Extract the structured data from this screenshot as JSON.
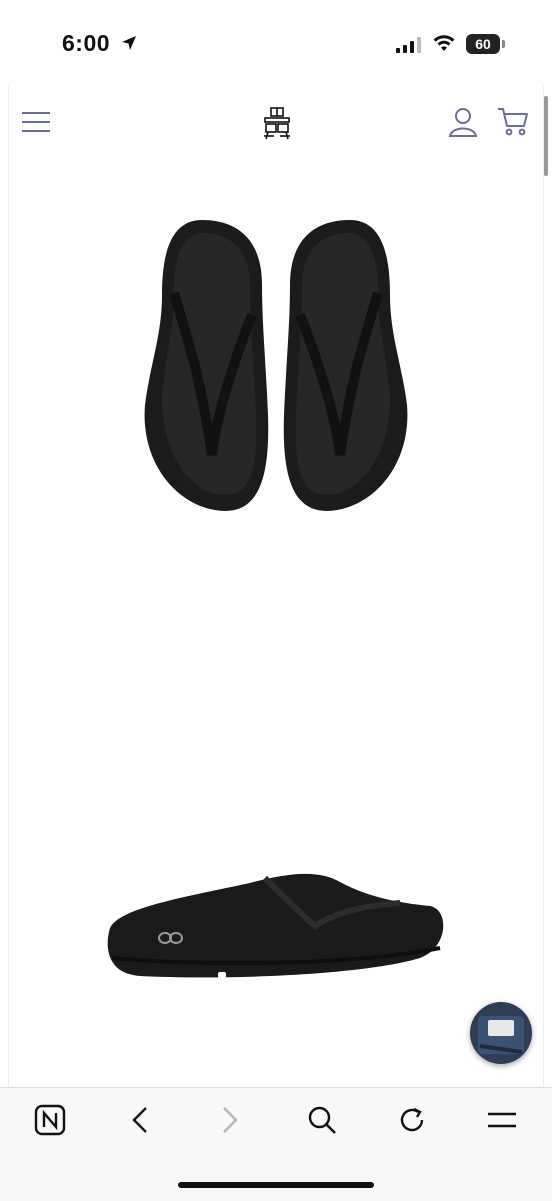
{
  "status_bar": {
    "time": "6:00",
    "battery_level": "60",
    "icons": [
      "location-arrow-icon",
      "cellular-signal-icon",
      "wifi-icon",
      "battery-icon"
    ]
  },
  "header": {
    "menu_icon": "hamburger-menu-icon",
    "logo": "store-logo",
    "account_icon": "user-icon",
    "cart_icon": "cart-icon",
    "accent_color": "#6b6f93"
  },
  "product": {
    "images": [
      "black-flip-flop-top-view",
      "black-flip-flop-side-view"
    ],
    "sole_logo": "oo"
  },
  "browser_toolbar": {
    "icons": [
      "newsguard-icon",
      "back-icon",
      "forward-icon",
      "search-icon",
      "reload-icon",
      "menu-icon"
    ]
  }
}
